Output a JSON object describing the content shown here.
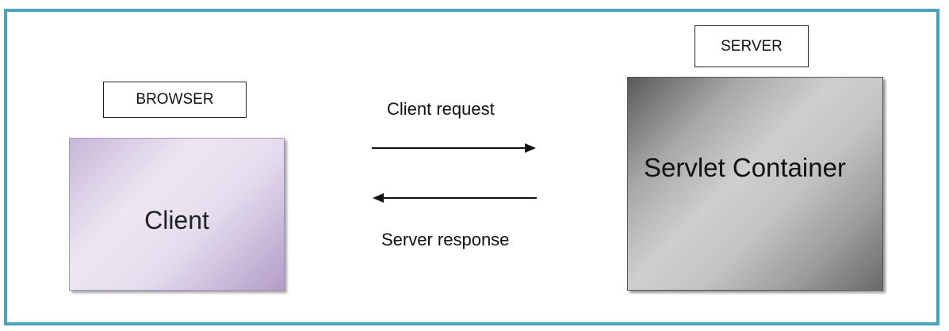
{
  "browser": {
    "label": "BROWSER",
    "node": "Client"
  },
  "server": {
    "label": "SERVER",
    "node": "Servlet Container"
  },
  "connections": {
    "request": "Client request",
    "response": "Server response"
  }
}
